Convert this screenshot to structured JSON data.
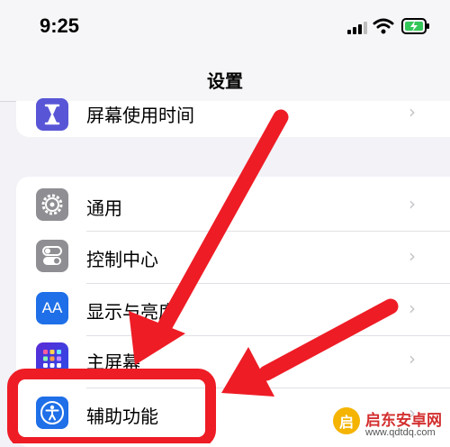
{
  "status_bar": {
    "time": "9:25"
  },
  "nav": {
    "title": "设置"
  },
  "settings": {
    "screen_time": {
      "label": "屏幕使用时间",
      "icon": "hourglass-icon",
      "color": "#5856d6"
    },
    "items": [
      {
        "label": "通用",
        "icon": "gear-icon",
        "color": "#8e8e93"
      },
      {
        "label": "控制中心",
        "icon": "toggles-icon",
        "color": "#8e8e93"
      },
      {
        "label": "显示与亮度",
        "icon": "aa-icon",
        "icon_text": "AA",
        "color": "#1e6fe8"
      },
      {
        "label": "主屏幕",
        "icon": "home-grid-icon",
        "color": "#3a3ae0"
      },
      {
        "label": "辅助功能",
        "icon": "accessibility-icon",
        "color": "#1e6fe8"
      }
    ]
  },
  "annotation": {
    "color": "#ee1c25"
  },
  "watermark": {
    "title": "启东安卓网",
    "url": "www.qdtdq.com",
    "badge": "启"
  }
}
